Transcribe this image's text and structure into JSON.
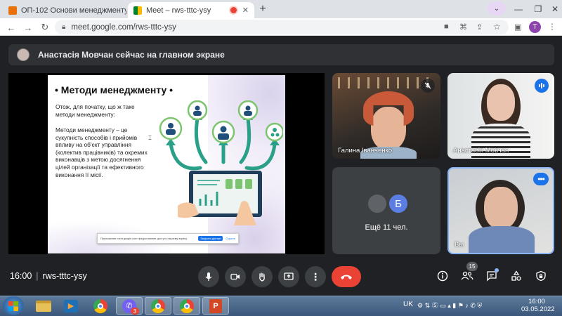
{
  "browser": {
    "tabs": [
      {
        "title": "ОП-102 Основи менеджменту",
        "favicon_color": "#e8710a"
      },
      {
        "title": "Meet – rws-tttc-ysy",
        "favicon_color": "#00832d"
      }
    ],
    "url": "meet.google.com/rws-tttc-ysy",
    "profile_initial": "T"
  },
  "meet": {
    "presenting_banner": "Анастасія Мовчан сейчас на главном экране",
    "time": "16:00",
    "meeting_code": "rws-tttc-ysy",
    "participants_badge": "15",
    "accent": "#1a73e8",
    "hangup_color": "#ea4335"
  },
  "slide": {
    "title": "Методи менеджменту",
    "intro_line1": "Отож, для початку, що ж таке",
    "intro_line2": "методи менеджменту:",
    "body_lines": [
      "Методи менеджменту – це",
      "сукупність способів і прийомів",
      "впливу на об'єкт управління",
      "(колектив працівників) та окремих",
      "виконавців з метою досягнення",
      "цілей організації та ефективного",
      "виконання її місії."
    ],
    "share_notice": "Приложение meet.google.com предоставляет доступ к вашему экрану.",
    "share_stop": "Закрыть доступ",
    "share_hide": "Скрыть"
  },
  "tiles": [
    {
      "name": "Галина Іванченко"
    },
    {
      "name": "Анастасія Мовчан"
    },
    {
      "name": "Ещё 11 чел.",
      "avatar_letter": "Б"
    },
    {
      "name": "Вы"
    }
  ],
  "taskbar": {
    "lang": "UK",
    "clock_time": "16:00",
    "clock_date": "03.05.2022",
    "viber_badge": "3"
  }
}
